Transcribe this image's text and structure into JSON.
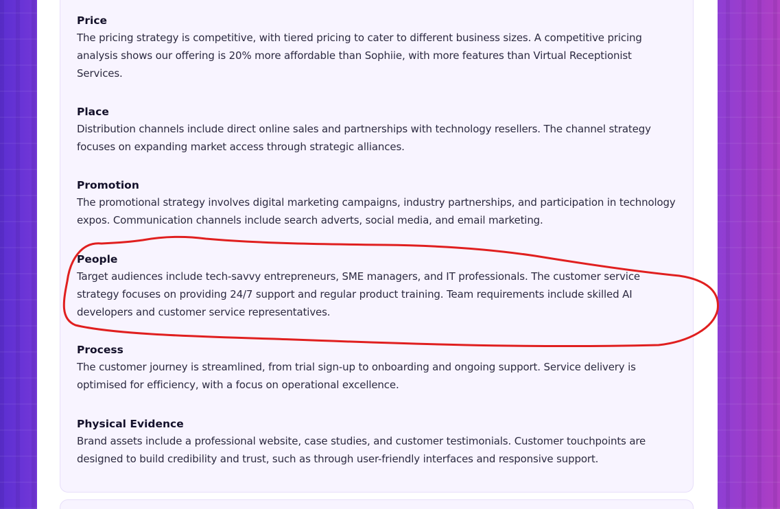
{
  "sections": [
    {
      "title": "Price",
      "body": "The pricing strategy is competitive, with tiered pricing to cater to different business sizes. A competitive pricing analysis shows our offering is 20% more affordable than Sophiie, with more features than Virtual Receptionist Services."
    },
    {
      "title": "Place",
      "body": "Distribution channels include direct online sales and partnerships with technology resellers. The channel strategy focuses on expanding market access through strategic alliances."
    },
    {
      "title": "Promotion",
      "body": "The promotional strategy involves digital marketing campaigns, industry partnerships, and participation in technology expos. Communication channels include search adverts, social media, and email marketing."
    },
    {
      "title": "People",
      "body": "Target audiences include tech-savvy entrepreneurs, SME managers, and IT professionals. The customer service strategy focuses on providing 24/7 support and regular product training. Team requirements include skilled AI developers and customer service representatives."
    },
    {
      "title": "Process",
      "body": "The customer journey is streamlined, from trial sign-up to onboarding and ongoing support. Service delivery is optimised for efficiency, with a focus on operational excellence."
    },
    {
      "title": "Physical Evidence",
      "body": "Brand assets include a professional website, case studies, and customer testimonials. Customer touchpoints are designed to build credibility and trust, such as through user-friendly interfaces and responsive support."
    }
  ],
  "annotation": {
    "color": "#e01f1f",
    "shape": "freehand-circle",
    "target": "People"
  },
  "colors": {
    "card_background": "#f8f4ff",
    "card_border": "#e7defa",
    "heading": "#14112a",
    "body_text": "#2c2a40"
  }
}
